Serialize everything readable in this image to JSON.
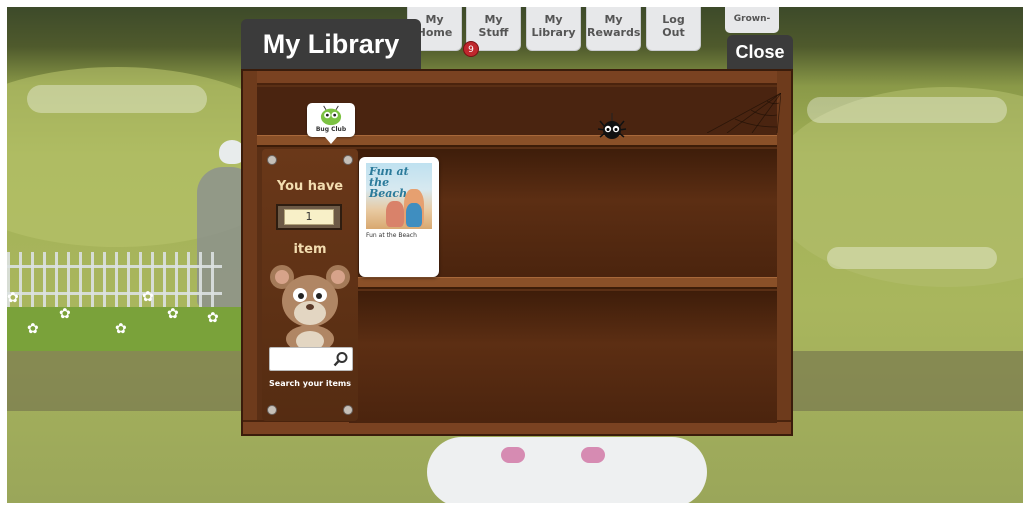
{
  "nav": {
    "tabs": [
      {
        "line1": "My",
        "line2": "Home"
      },
      {
        "line1": "My",
        "line2": "Stuff"
      },
      {
        "line1": "My",
        "line2": "Library"
      },
      {
        "line1": "My",
        "line2": "Rewards"
      },
      {
        "line1": "Log",
        "line2": "Out"
      }
    ],
    "badge": "9",
    "grownups": "Grown-ups"
  },
  "modal": {
    "title": "My Library",
    "close": "Close"
  },
  "side_panel": {
    "you_have": "You have",
    "count": "1",
    "item_label": "item",
    "search_placeholder": "",
    "search_hint": "Search your items"
  },
  "bug_club": {
    "label": "Bug Club"
  },
  "books": [
    {
      "title": "Fun at the Beach",
      "cover_title": "Fun at the Beach"
    }
  ],
  "colors": {
    "modal_dark": "#3b3b3b",
    "wood": "#6e3b1c",
    "badge_red": "#c0272d",
    "bug_green": "#7cc242"
  }
}
